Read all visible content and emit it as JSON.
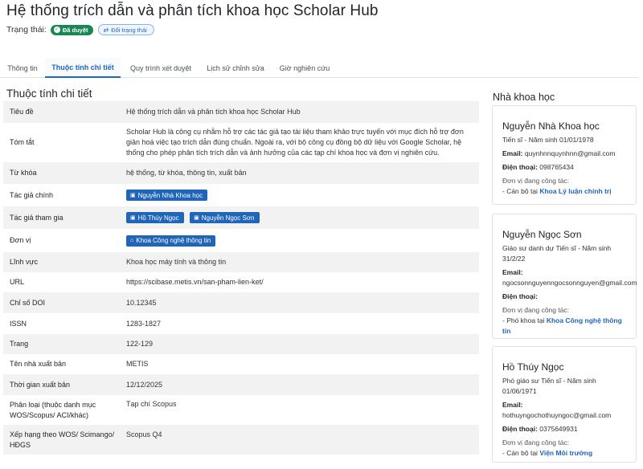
{
  "page": {
    "title": "Hệ thống trích dẫn và phân tích khoa học Scholar Hub",
    "status_label": "Trạng thái:",
    "status_badge": "Đã duyệt",
    "change_status_button": "Đổi trạng thái"
  },
  "tabs": [
    {
      "label": "Thông tin"
    },
    {
      "label": "Thuộc tính chi tiết"
    },
    {
      "label": "Quy trình xét duyệt"
    },
    {
      "label": "Lịch sử chỉnh sửa"
    },
    {
      "label": "Giờ nghiên cứu"
    }
  ],
  "details": {
    "section_title": "Thuộc tính chi tiết",
    "rows": [
      {
        "key": "Tiêu đề",
        "value": "Hệ thống trích dẫn và phân tích khoa học Scholar Hub"
      },
      {
        "key": "Tóm tắt",
        "value": "Scholar Hub là công cụ nhằm hỗ trợ các tác giả tạo tài liệu tham khảo trực tuyến với mục đích hỗ trợ đơn giản hoá việc tạo trích dẫn đúng chuẩn. Ngoài ra, với bộ công cụ đồng bộ dữ liệu với Google Scholar, hệ thống cho phép phân tích trích dẫn và ảnh hưởng của các tạp chí khoa học và đơn vị nghiên cứu."
      },
      {
        "key": "Từ khóa",
        "value": "hệ thống, từ khóa, thông tin, xuất bản"
      },
      {
        "key": "Tác giả chính",
        "chips": [
          "Nguyễn Nhà Khoa học"
        ]
      },
      {
        "key": "Tác giả tham gia",
        "chips": [
          "Hồ Thúy Ngọc",
          "Nguyễn Ngọc Sơn"
        ]
      },
      {
        "key": "Đơn vị",
        "chips": [
          "Khoa Công nghệ thông tin"
        ]
      },
      {
        "key": "Lĩnh vực",
        "value": "Khoa học máy tính và thông tin"
      },
      {
        "key": "URL",
        "value": "https://scibase.metis.vn/san-pham-lien-ket/"
      },
      {
        "key": "Chỉ số DOI",
        "value": "10.12345"
      },
      {
        "key": "ISSN",
        "value": "1283-1827"
      },
      {
        "key": "Trang",
        "value": "122-129"
      },
      {
        "key": "Tên nhà xuất bản",
        "value": "METIS"
      },
      {
        "key": "Thời gian xuất bản",
        "value": "12/12/2025"
      },
      {
        "key": "Phân loại (thuộc danh mục WOS/Scopus/ ACI/khác)",
        "value": "Tạp chí Scopus"
      },
      {
        "key": "Xếp hạng theo WOS/ Scimango/ HĐGS",
        "value": "Scopus Q4"
      }
    ]
  },
  "scientists": {
    "title": "Nhà khoa học",
    "email_label": "Email:",
    "phone_label": "Điện thoại:",
    "unit_label": "Đơn vị đang công tác:",
    "cards": [
      {
        "name": "Nguyễn Nhà Khoa học",
        "degree": "Tiến sĩ  - Năm sinh 01/01/1978",
        "email": "quynhnnquynhnn@gmail.com",
        "phone": "098765434",
        "role": " - Cán bộ tại ",
        "unit": "Khoa Lý luận chính trị"
      },
      {
        "name": "Nguyễn Ngọc Sơn",
        "degree": "Giáo sư danh dự Tiến sĩ  - Năm sinh 31/2/22",
        "email": "ngocsonnguyenngocsonnguyen@gmail.com",
        "phone": "",
        "role": " - Phó khoa tại ",
        "unit": "Khoa Công nghệ thông tin"
      },
      {
        "name": "Hồ Thúy Ngọc",
        "degree": "Phó giáo sư Tiến sĩ  - Năm sinh 01/06/1971",
        "email": "hothuyngochothuyngoc@gmail.com",
        "phone": "0375649931",
        "role": " - Cán bộ tại ",
        "unit": "Viện Môi trường"
      }
    ]
  },
  "colors": {
    "accent": "#1f65b8",
    "success": "#198754",
    "row_alt": "#f2f2f2"
  },
  "icons": {
    "status_badge": "check-circle-icon",
    "change_status": "swap-arrows-icon",
    "person_chip": "person-badge-icon",
    "unit_chip": "bank-icon"
  }
}
